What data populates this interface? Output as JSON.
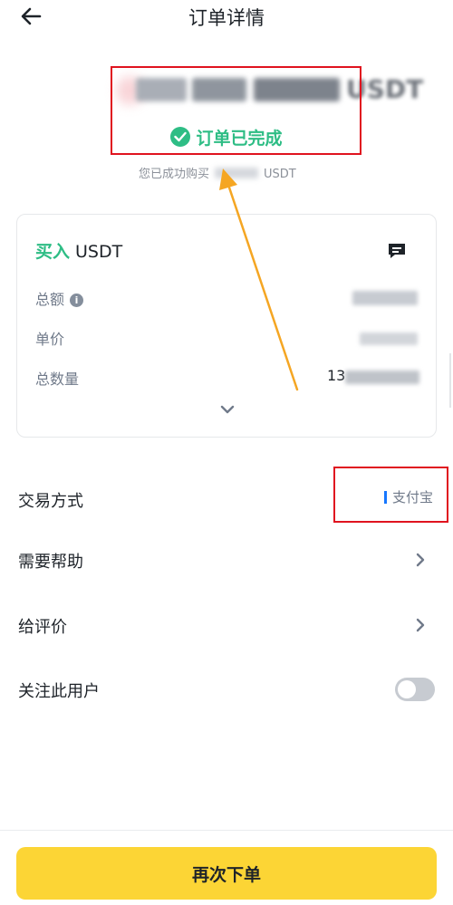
{
  "header": {
    "title": "订单详情"
  },
  "summary": {
    "amount_unit": "USDT",
    "status_text": "订单已完成",
    "sub_prefix": "您已成功购买",
    "sub_unit": "USDT"
  },
  "card": {
    "side": "买入",
    "coin": "USDT",
    "rows": [
      {
        "label": "总额"
      },
      {
        "label": "单价"
      },
      {
        "label": "总数量",
        "value_prefix": "13"
      }
    ]
  },
  "rows": {
    "trade_method_label": "交易方式",
    "trade_method_value": "支付宝",
    "help_label": "需要帮助",
    "review_label": "给评价",
    "follow_label": "关注此用户"
  },
  "footer": {
    "reorder_label": "再次下单"
  },
  "colors": {
    "accent_yellow": "#fcd535",
    "buy_green": "#2ebd85",
    "annotation_red": "#e0131f",
    "annotation_arrow": "#f5a623",
    "alipay_blue": "#1677ff"
  }
}
